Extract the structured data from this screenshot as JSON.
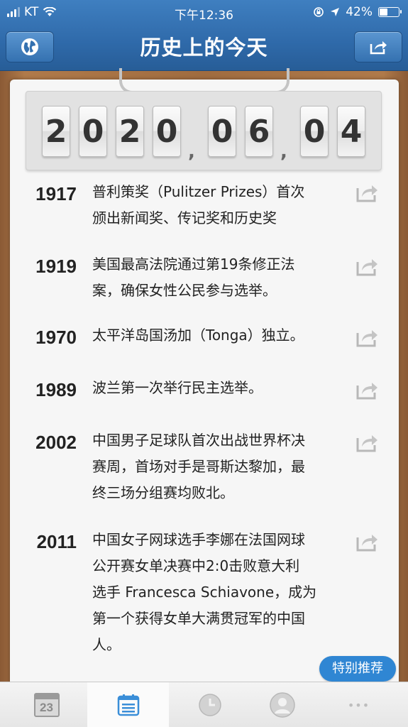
{
  "status_bar": {
    "carrier": "KT",
    "time": "下午12:36",
    "battery_percent": "42%",
    "battery_level": 0.42
  },
  "header": {
    "title": "历史上的今天",
    "left_icon": "globe-icon",
    "right_icon": "share-icon"
  },
  "date": {
    "digits": [
      "2",
      "0",
      "2",
      "0",
      "0",
      "6",
      "0",
      "4"
    ],
    "separator": ","
  },
  "events": [
    {
      "year": "1917",
      "lines": [
        "普利策奖（Pulitzer Prizes）首次",
        "颁出新闻奖、传记奖和历史奖"
      ]
    },
    {
      "year": "1919",
      "lines": [
        "美国最高法院通过第19条修正法",
        "案，确保女性公民参与选举。"
      ]
    },
    {
      "year": "1970",
      "lines": [
        "太平洋岛国汤加（Tonga）独立。"
      ]
    },
    {
      "year": "1989",
      "lines": [
        "波兰第一次举行民主选举。"
      ]
    },
    {
      "year": "2002",
      "lines": [
        "中国男子足球队首次出战世界杯决",
        "赛周，首场对手是哥斯达黎加，最",
        "终三场分组赛均败北。"
      ]
    },
    {
      "year": "2011",
      "lines": [
        "中国女子网球选手李娜在法国网球",
        "公开赛女单决赛中2:0击败意大利",
        "选手 Francesca Schiavone，成为",
        "第一个获得女单大满贯冠军的中国",
        "人。"
      ]
    }
  ],
  "badge": {
    "label": "特别推荐"
  },
  "tabs": [
    {
      "icon": "calendar-day-icon",
      "label": "23"
    },
    {
      "icon": "list-icon",
      "active": true
    },
    {
      "icon": "clock-icon"
    },
    {
      "icon": "user-icon"
    },
    {
      "icon": "more-icon",
      "label": "•••"
    }
  ],
  "colors": {
    "header_blue": "#2f6aaa",
    "badge_blue": "#2f86d3",
    "active_tab_blue": "#3a8ed8"
  }
}
